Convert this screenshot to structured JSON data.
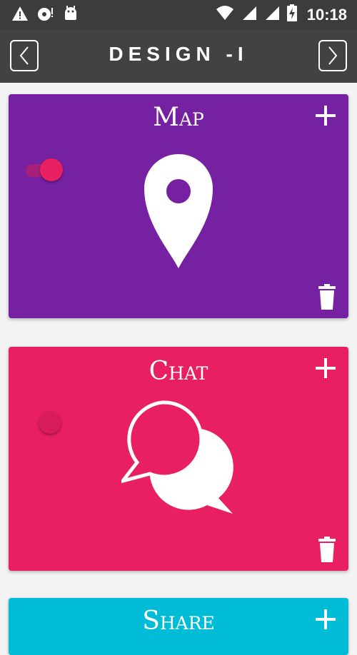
{
  "status_bar": {
    "time": "10:18",
    "icons": [
      "warning-icon",
      "photo-alert-icon",
      "android-icon",
      "wifi-icon",
      "signal-icon",
      "signal-icon",
      "battery-charging-icon"
    ]
  },
  "app_bar": {
    "title": "DESIGN -I",
    "back_icon": "chevron-left-icon",
    "forward_icon": "chevron-right-icon"
  },
  "cards": [
    {
      "title": "Map",
      "color": "#7620a2",
      "icon": "location-pin-icon",
      "toggle_on": true,
      "add_icon": "plus-icon",
      "delete_icon": "trash-icon"
    },
    {
      "title": "Chat",
      "color": "#e81f61",
      "icon": "chat-bubbles-icon",
      "toggle_on": false,
      "add_icon": "plus-icon",
      "delete_icon": "trash-icon"
    },
    {
      "title": "Share",
      "color": "#00bcd6",
      "add_icon": "plus-icon"
    }
  ]
}
